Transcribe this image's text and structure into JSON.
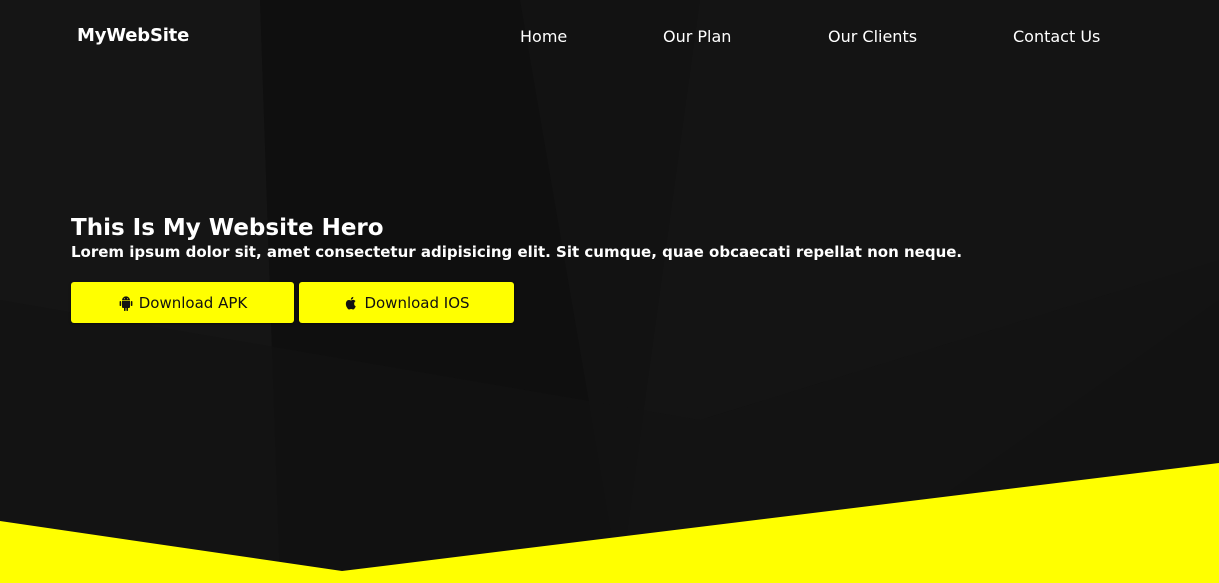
{
  "brand": {
    "name": "MyWebSite"
  },
  "nav": {
    "items": [
      {
        "label": "Home"
      },
      {
        "label": "Our Plan"
      },
      {
        "label": "Our Clients"
      },
      {
        "label": "Contact Us"
      }
    ]
  },
  "hero": {
    "title": "This Is My Website Hero",
    "text": "Lorem ipsum dolor sit, amet consectetur adipisicing elit. Sit cumque, quae obcaecati repellat non neque.",
    "buttons": [
      {
        "label": "Download APK",
        "icon": "android-icon"
      },
      {
        "label": "Download IOS",
        "icon": "apple-icon"
      }
    ]
  },
  "colors": {
    "accent": "#ffff00",
    "background": "#121212",
    "text": "#ffffff"
  }
}
